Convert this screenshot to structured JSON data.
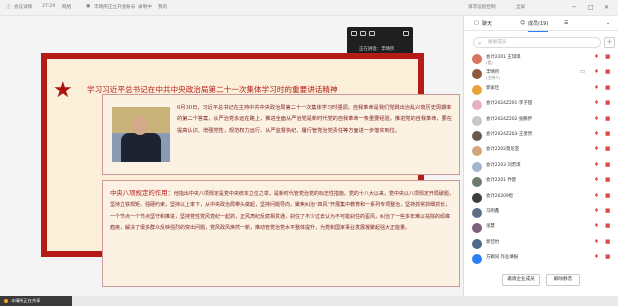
{
  "topbar": {
    "app_name": "会议详情",
    "timer": "27:29",
    "network": "网络",
    "meeting_title": "丰晴所正立开会账号",
    "record_label": "录制中",
    "mine_label": "我的",
    "request_control_label": "请求远程控制",
    "fullscreen_label": "全屏"
  },
  "statebar": {
    "status_label": "正在讲话",
    "speaker": "丰晴所"
  },
  "slide": {
    "title": "学习习近平总书记在中共中央政治局第二十一次集体学习时的重要讲话精神",
    "para1": "6月30日，习近平总书记在主持中共中央政治局第二十一次集体学习时强调，自我革命是我们党跳出治乱兴衰历史周期率的第二个答案，从严治党永远在路上，推进全面从严治党是新时代党的自我革命一条重要经验。推进党的自我革命，要在提高认识、增强党性，规范权力运行、从严监督执纪、履行管党治党责任等方面进一步落实到位。",
    "para2_heading": "中央八项规定的作用：",
    "para2": "他指出中央八项规定是党中央统本立位之举，是新时代管党治党的标志性措施。党的十八大以来，党中央以八项规定开局破题，坚持立铁规矩、强硬约束，坚持以上率下，从中央政治局带头做起，坚持问题导向，聚焦纠治“四风”开展集中教育和一系列专项整治，坚持抓常抓细抓长，一个节点一个节点坚守和推进，坚持党性党风党纪一起抓，正风肃纪反腐相贯通，刹住了不少过去认为不可能刹住的歪风，纠治了一些多年难以祛除的顽瘴痼疾，解决了很多群众反映强烈的突出问题，党风政风焕然一新，推动管党治党水平整体提升，为党和国家事业发展凝聚起强大正能量。"
  },
  "share_badge": {
    "label": "丰晴所正在共享"
  },
  "panel": {
    "tab_chat": "聊天",
    "tab_members": "成员(19)",
    "search_placeholder": "搜索成员",
    "members": [
      {
        "name": "会计2201 王琪琪",
        "sub": "(我)",
        "color": "#d8745f",
        "screen": false,
        "mic": true,
        "cam": true
      },
      {
        "name": "丰晴所",
        "sub": "(主持人)",
        "color": "#8b5a3c",
        "screen": true,
        "mic": true,
        "cam": true
      },
      {
        "name": "郭家佳",
        "sub": "",
        "color": "#e6a43a",
        "screen": false,
        "mic": true,
        "cam": true
      },
      {
        "name": "会计2024Z201-李子甜",
        "sub": "",
        "color": "#e9b0c2",
        "screen": false,
        "mic": true,
        "cam": true
      },
      {
        "name": "会计2024Z202 张鹏伊",
        "sub": "",
        "color": "#c8c8c8",
        "screen": false,
        "mic": true,
        "cam": true
      },
      {
        "name": "会计2024Z203-王斐然",
        "sub": "",
        "color": "#6a5a4a",
        "screen": false,
        "mic": true,
        "cam": true
      },
      {
        "name": "会计2202莫尼亚",
        "sub": "",
        "color": "#d4a47a",
        "screen": false,
        "mic": true,
        "cam": true
      },
      {
        "name": "会计2203 刘若琪",
        "sub": "",
        "color": "#9fb6d0",
        "screen": false,
        "mic": true,
        "cam": true
      },
      {
        "name": "会计2201 乔楚",
        "sub": "",
        "color": "#6b7d6b",
        "screen": false,
        "mic": true,
        "cam": true
      },
      {
        "name": "会计20209智",
        "sub": "",
        "color": "#3d3d3d",
        "screen": false,
        "mic": true,
        "cam": true
      },
      {
        "name": "马明鑫",
        "sub": "",
        "color": "#5c6f86",
        "screen": false,
        "mic": true,
        "cam": true
      },
      {
        "name": "张慧",
        "sub": "",
        "color": "#7c5f7a",
        "screen": false,
        "mic": true,
        "cam": true
      },
      {
        "name": "郭佳怡",
        "sub": "",
        "color": "#4e6a8a",
        "screen": false,
        "mic": true,
        "cam": true
      },
      {
        "name": "方颖同 作业填报",
        "sub": "",
        "color": "#2d7ff9",
        "screen": false,
        "mic": true,
        "cam": true
      }
    ],
    "invite_button": "邀请企业成员",
    "mute_button": "解除静音"
  }
}
